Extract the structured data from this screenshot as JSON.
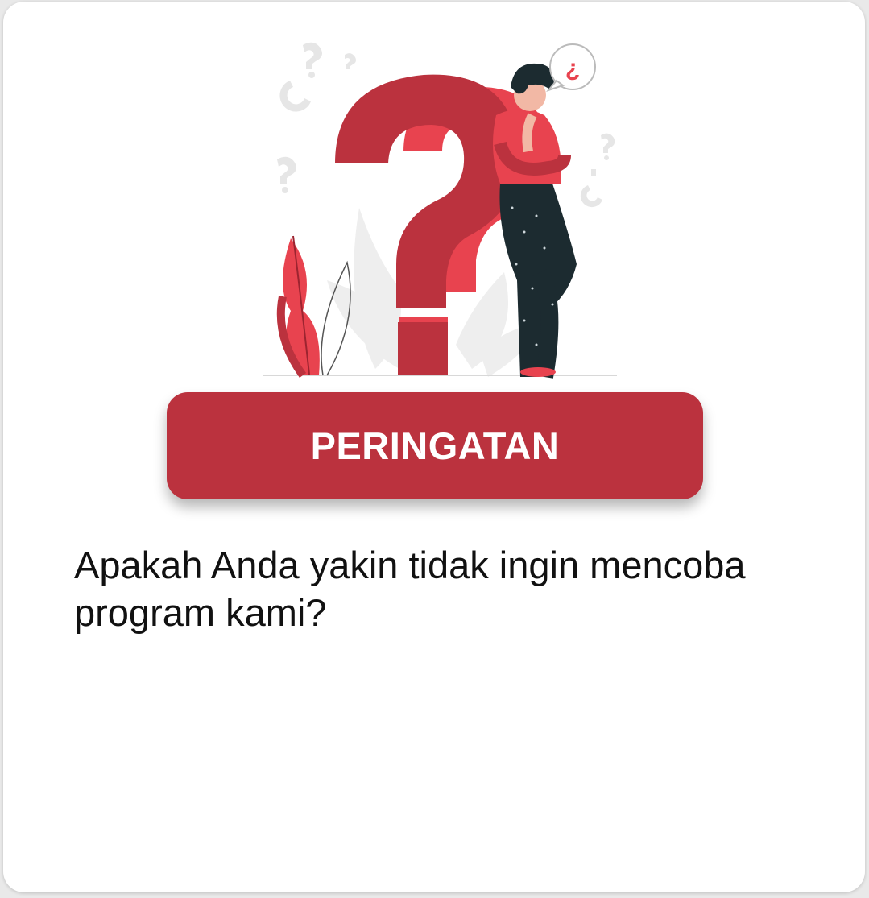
{
  "dialog": {
    "title": "PERINGATAN",
    "message": "Apakah Anda yakin tidak ingin mencoba program kami?",
    "illustration_icon": "confused-person-question-mark-illustration"
  },
  "colors": {
    "accent": "#bb323e",
    "accent_light": "#e8434f",
    "ink": "#1c2b30",
    "background": "#ffffff"
  }
}
